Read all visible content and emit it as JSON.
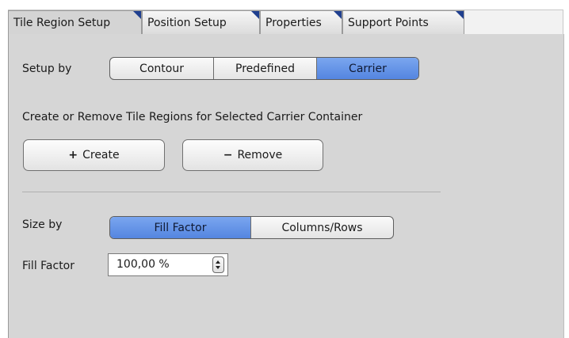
{
  "tabs": [
    {
      "label": "Tile Region Setup",
      "active": true
    },
    {
      "label": "Position Setup",
      "active": false
    },
    {
      "label": "Properties",
      "active": false
    },
    {
      "label": "Support Points",
      "active": false
    }
  ],
  "setup_by": {
    "label": "Setup by",
    "options": [
      "Contour",
      "Predefined",
      "Carrier"
    ],
    "selected": "Carrier"
  },
  "carrier_section": {
    "description": "Create or Remove Tile Regions for Selected Carrier Container",
    "create_label": "Create",
    "create_glyph": "+",
    "remove_label": "Remove",
    "remove_glyph": "−"
  },
  "size_by": {
    "label": "Size by",
    "options": [
      "Fill Factor",
      "Columns/Rows"
    ],
    "selected": "Fill Factor"
  },
  "fill_factor": {
    "label": "Fill Factor",
    "value": "100,00 %"
  },
  "colors": {
    "selected_segment": "#5e8fe6",
    "panel_background": "#d6d6d6",
    "tab_corner_marker": "#1f3f8f"
  }
}
